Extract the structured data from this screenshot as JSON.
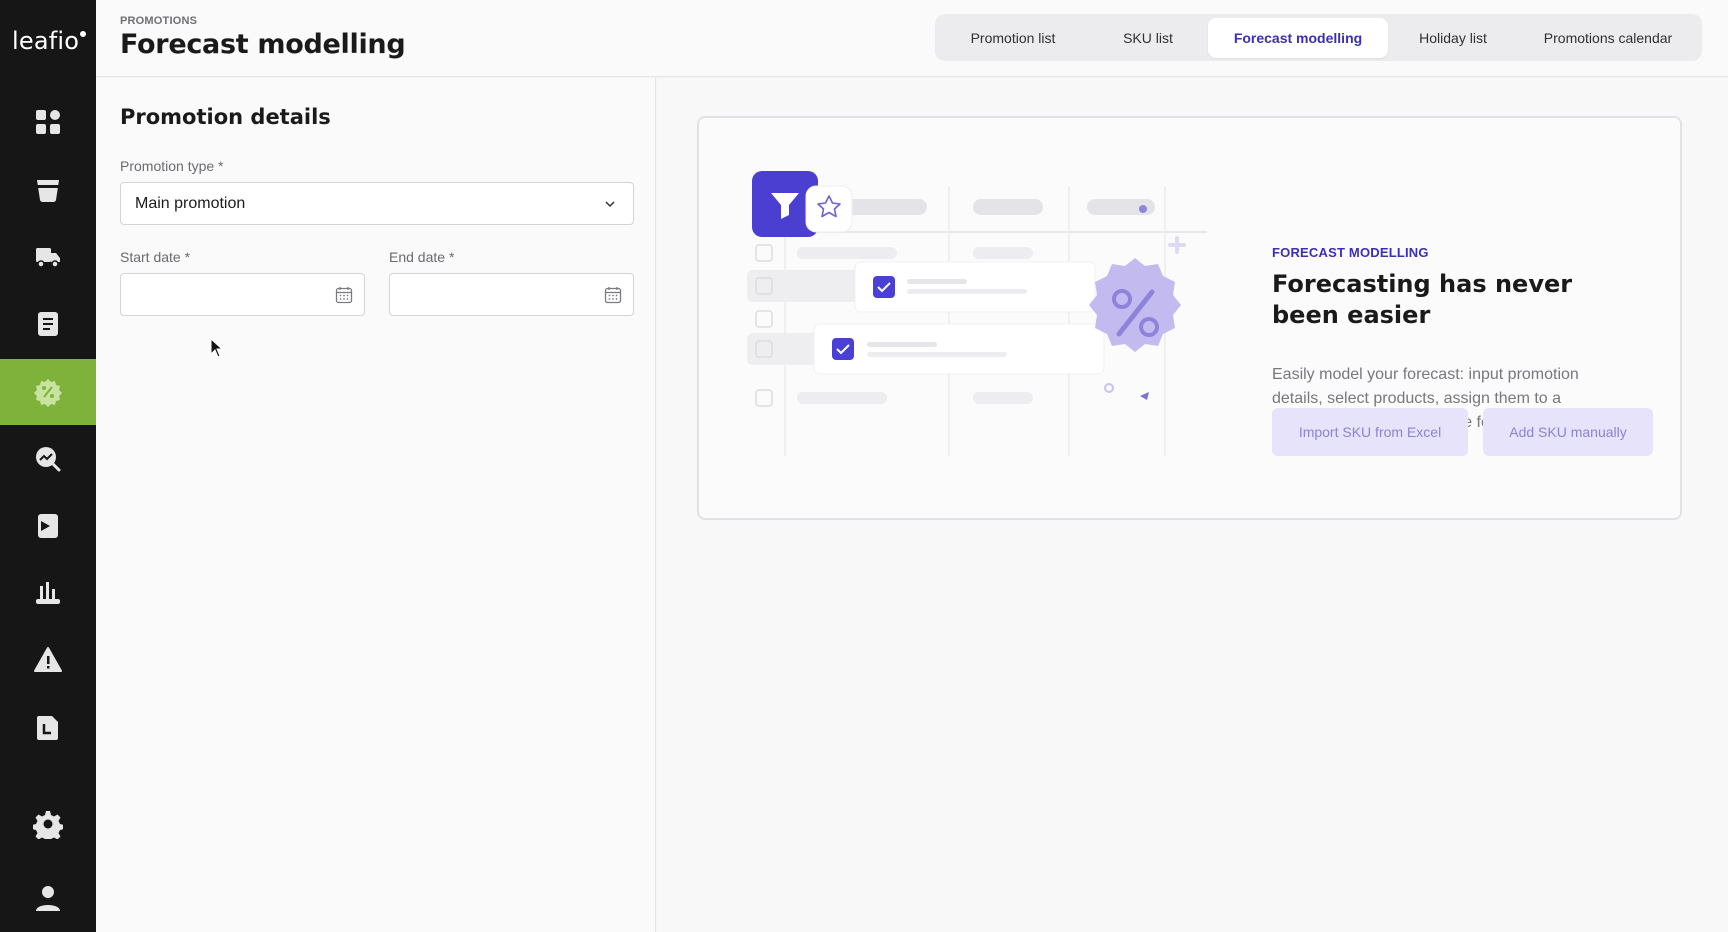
{
  "app": {
    "logo_text": "leafio",
    "accent": "#7fb23a",
    "primary": "#3a2fb5"
  },
  "sidebar": {
    "items": [
      {
        "name": "dashboard-icon",
        "active": false
      },
      {
        "name": "cup-icon",
        "active": false
      },
      {
        "name": "truck-icon",
        "active": false
      },
      {
        "name": "document-list-icon",
        "active": false
      },
      {
        "name": "promo-percent-icon",
        "active": true
      },
      {
        "name": "trend-search-icon",
        "active": false
      },
      {
        "name": "bookmark-flag-icon",
        "active": false
      },
      {
        "name": "bar-chart-icon",
        "active": false
      },
      {
        "name": "warning-icon",
        "active": false
      },
      {
        "name": "file-l-icon",
        "active": false
      },
      {
        "name": "settings-gear-icon",
        "active": false
      },
      {
        "name": "user-profile-icon",
        "active": false
      }
    ]
  },
  "header": {
    "breadcrumb": "PROMOTIONS",
    "title": "Forecast modelling",
    "tabs": [
      {
        "label": "Promotion list",
        "active": false
      },
      {
        "label": "SKU list",
        "active": false
      },
      {
        "label": "Forecast modelling",
        "active": true
      },
      {
        "label": "Holiday list",
        "active": false
      },
      {
        "label": "Promotions calendar",
        "active": false
      }
    ]
  },
  "form": {
    "section_title": "Promotion details",
    "promotion_type_label": "Promotion type  *",
    "promotion_type_value": "Main promotion",
    "start_date_label": "Start date *",
    "start_date_value": "",
    "end_date_label": "End date *",
    "end_date_value": ""
  },
  "card": {
    "eyebrow": "FORECAST MODELLING",
    "heading": "Forecasting has never been easier",
    "description": "Easily model your forecast: input promotion details, select products, assign them to a format, and instantly receive forecasted values.",
    "import_button": "Import SKU from Excel",
    "add_button": "Add SKU manually"
  }
}
